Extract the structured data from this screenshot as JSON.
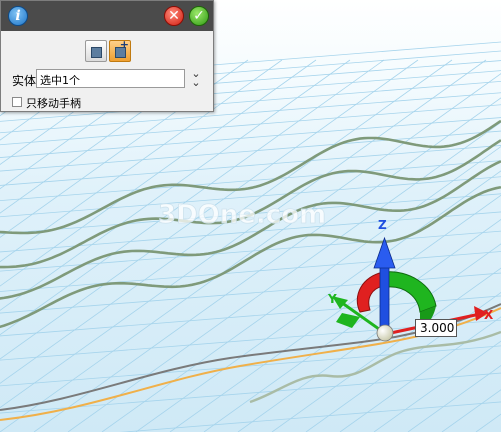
{
  "panel": {
    "entity_label": "实体",
    "entity_value": "选中1个",
    "move_handle_label": "只移动手柄"
  },
  "viewport": {
    "axes": {
      "x": "X",
      "y": "Y",
      "z": "Z"
    },
    "value_input": "3.000",
    "watermark": "3DOne.com"
  },
  "colors": {
    "grid_background": "#d8eef8",
    "grid_line": "#a6d4ec",
    "wave_curve": "#7f9a7a",
    "x_axis": "#e02020",
    "y_axis": "#1fb51f",
    "z_axis": "#1f4fe0",
    "path_orange": "#f0b04a",
    "path_gray": "#7a7a7a",
    "titlebar": "#4b4b4b"
  },
  "icons": [
    "info-icon",
    "close-icon",
    "confirm-icon",
    "move-entity-icon",
    "add-entity-icon",
    "expand-icon"
  ]
}
